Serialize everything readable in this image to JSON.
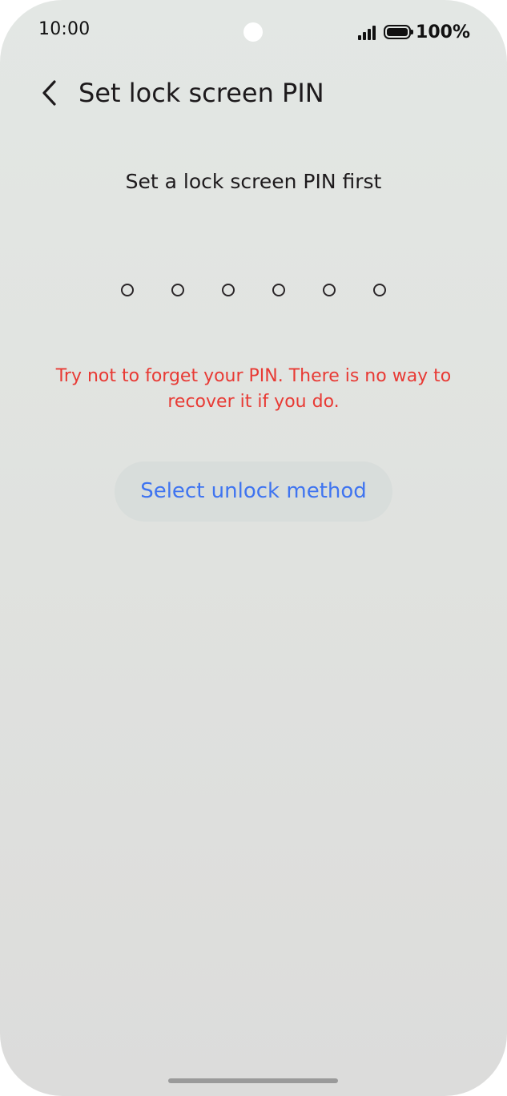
{
  "status_bar": {
    "time": "10:00",
    "battery_percent": "100%",
    "signal_bars": 4,
    "battery_icon": "battery-full-icon",
    "signal_icon": "signal-icon"
  },
  "header": {
    "back_icon": "chevron-left-icon",
    "title": "Set lock screen PIN"
  },
  "main": {
    "prompt": "Set a lock screen PIN first",
    "pin_length": 6,
    "pin_filled": 0,
    "warning": "Try not to forget your PIN. There is no way to recover it if you do.",
    "unlock_method_label": "Select unlock method"
  },
  "colors": {
    "warning": "#e83a34",
    "accent": "#3f74f0",
    "button_bg": "#d8dddb",
    "background": "#e1e4e1"
  }
}
